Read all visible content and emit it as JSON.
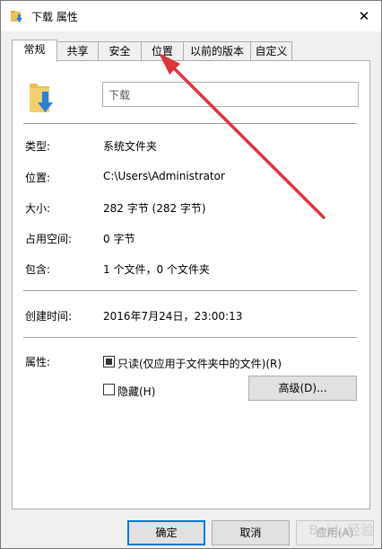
{
  "window": {
    "title": "下载 属性",
    "close_glyph": "✕"
  },
  "tabs": [
    {
      "label": "常规",
      "active": true
    },
    {
      "label": "共享",
      "active": false
    },
    {
      "label": "安全",
      "active": false
    },
    {
      "label": "位置",
      "active": false
    },
    {
      "label": "以前的版本",
      "active": false
    },
    {
      "label": "自定义",
      "active": false
    }
  ],
  "general": {
    "name_value": "下载",
    "type_label": "类型:",
    "type_value": "系统文件夹",
    "location_label": "位置:",
    "location_value": "C:\\Users\\Administrator",
    "size_label": "大小:",
    "size_value": "282 字节 (282 字节)",
    "size_on_disk_label": "占用空间:",
    "size_on_disk_value": "0 字节",
    "contains_label": "包含:",
    "contains_value": "1 个文件，0 个文件夹",
    "created_label": "创建时间:",
    "created_value": "2016年7月24日，23:00:13",
    "attributes_label": "属性:",
    "readonly_label": "只读(仅应用于文件夹中的文件)(R)",
    "readonly_checked": true,
    "hidden_label": "隐藏(H)",
    "hidden_checked": false,
    "advanced_button": "高级(D)..."
  },
  "footer": {
    "ok_button": "确定",
    "cancel_button": "取消",
    "apply_button": "应用(A)"
  },
  "annotation": {
    "arrow_color": "#e0343c"
  },
  "watermark": "Baidu经验",
  "colors": {
    "folder_yellow": "#e8c15a",
    "arrow_blue": "#2b7fd6",
    "default_button_border": "#0078d7"
  },
  "icons": {
    "title": "download-folder-icon",
    "close": "close-icon",
    "large": "download-folder-icon"
  }
}
